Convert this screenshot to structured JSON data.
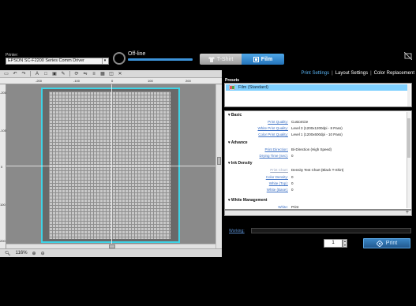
{
  "header": {
    "printer_label": "Printer:",
    "printer_value": "EPSON SC-F2200 Series Comm Driver",
    "status_text": "Off-line",
    "tab_tshirt": "T-Shirt",
    "tab_film": "Film"
  },
  "toolbar": {
    "icons": [
      "document-icon",
      "undo-icon",
      "redo-icon",
      "text-icon",
      "rectangle-icon",
      "image-icon",
      "pen-icon",
      "rotate-icon",
      "flip-icon",
      "align-icon",
      "grid-icon",
      "layers-icon",
      "delete-icon"
    ]
  },
  "rulers": {
    "top": [
      "-200",
      "-100",
      "0",
      "100",
      "200"
    ],
    "left": [
      "-200",
      "-100",
      "0",
      "100",
      "200"
    ]
  },
  "zoom": {
    "value": "116%"
  },
  "menu": {
    "print_settings": "Print Settings",
    "layout_settings": "Layout Settings",
    "color_replacement": "Color Replacement",
    "separator": "|"
  },
  "presets": {
    "label": "Presets",
    "selected": "Film (Standard)"
  },
  "settings": {
    "basic": {
      "title": "Basic",
      "print_quality_label": "Print Quality:",
      "print_quality_value": "Customize",
      "white_print_quality_label": "White Print Quality:",
      "white_print_quality_value": "Level 3 (1200x1200dpi - 8 Pass)",
      "color_print_quality_label": "Color Print Quality:",
      "color_print_quality_value": "Level 1 (1200x600dpi - 10 Pass)"
    },
    "advance": {
      "title": "Advance",
      "print_direction_label": "Print Direction:",
      "print_direction_value": "Bi-Direction (High Speed)",
      "drying_time_label": "Drying Time (sec):",
      "drying_time_value": "0"
    },
    "ink_density": {
      "title": "Ink Density",
      "print_chart_label": "Print Chart:",
      "print_chart_value": "Density Test Chart (Black T-Shirt)",
      "color_density_label": "Color Density:",
      "color_density_value": "0",
      "white_top_label": "White (Top):",
      "white_top_value": "0",
      "white_base_label": "White (Base):",
      "white_base_value": "0"
    },
    "white_management": {
      "title": "White Management",
      "white_label": "White:",
      "white_value": "Print"
    }
  },
  "footer": {
    "working_label": "Working:",
    "working_value": "",
    "copies": "1",
    "print_button": "Print"
  },
  "colors": {
    "accent": "#3c93d9",
    "film_outline": "#3fd3e6",
    "active_tab": "#5ab3f2"
  }
}
